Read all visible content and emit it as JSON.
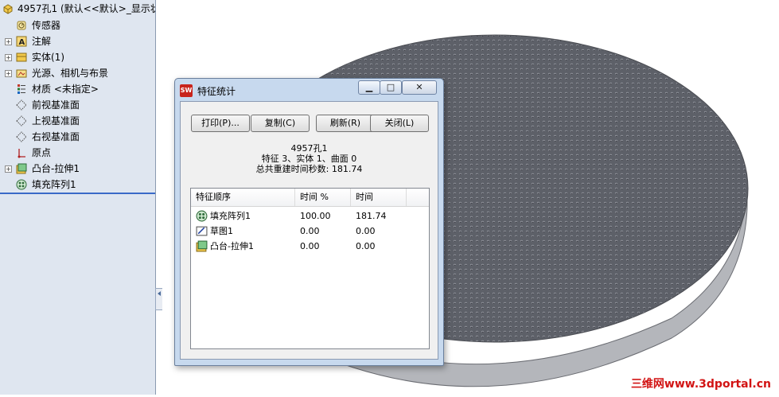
{
  "tree": {
    "root_label": "4957孔1  (默认<<默认>_显示状",
    "items": [
      {
        "label": "传感器",
        "icon": "sensor-icon",
        "expand": false
      },
      {
        "label": "注解",
        "icon": "annotation-icon",
        "expand": true
      },
      {
        "label": "实体(1)",
        "icon": "solid-body-icon",
        "expand": true
      },
      {
        "label": "光源、相机与布景",
        "icon": "lights-cameras-icon",
        "expand": true
      },
      {
        "label": "材质 <未指定>",
        "icon": "material-icon",
        "expand": false
      },
      {
        "label": "前视基准面",
        "icon": "plane-icon",
        "expand": false
      },
      {
        "label": "上视基准面",
        "icon": "plane-icon",
        "expand": false
      },
      {
        "label": "右视基准面",
        "icon": "plane-icon",
        "expand": false
      },
      {
        "label": "原点",
        "icon": "origin-icon",
        "expand": false
      },
      {
        "label": "凸台-拉伸1",
        "icon": "boss-extrude-icon",
        "expand": true
      },
      {
        "label": "填充阵列1",
        "icon": "fill-pattern-icon",
        "expand": false
      }
    ]
  },
  "dialog": {
    "title": "特征统计",
    "buttons": {
      "print": "打印(P)...",
      "copy": "复制(C)",
      "refresh": "刷新(R)",
      "close": "关闭(L)"
    },
    "summary": {
      "part_name": "4957孔1",
      "counts": "特征 3、实体 1、曲面 0",
      "total_time": "总共重建时间秒数: 181.74"
    },
    "columns": [
      "特征顺序",
      "时间 %",
      "时间"
    ],
    "rows": [
      {
        "name": "填充阵列1",
        "pct": "100.00",
        "time": "181.74",
        "icon": "fill-pattern-icon"
      },
      {
        "name": "草图1",
        "pct": "0.00",
        "time": "0.00",
        "icon": "sketch-icon"
      },
      {
        "name": "凸台-拉伸1",
        "pct": "0.00",
        "time": "0.00",
        "icon": "boss-extrude-icon"
      }
    ]
  },
  "watermark": "三维网www.3dportal.cn",
  "colors": {
    "tree_bg": "#dfe6f0",
    "dialog_frame": "#c7d9ee",
    "model_gray": "#6b6e76",
    "watermark": "#d21414"
  }
}
